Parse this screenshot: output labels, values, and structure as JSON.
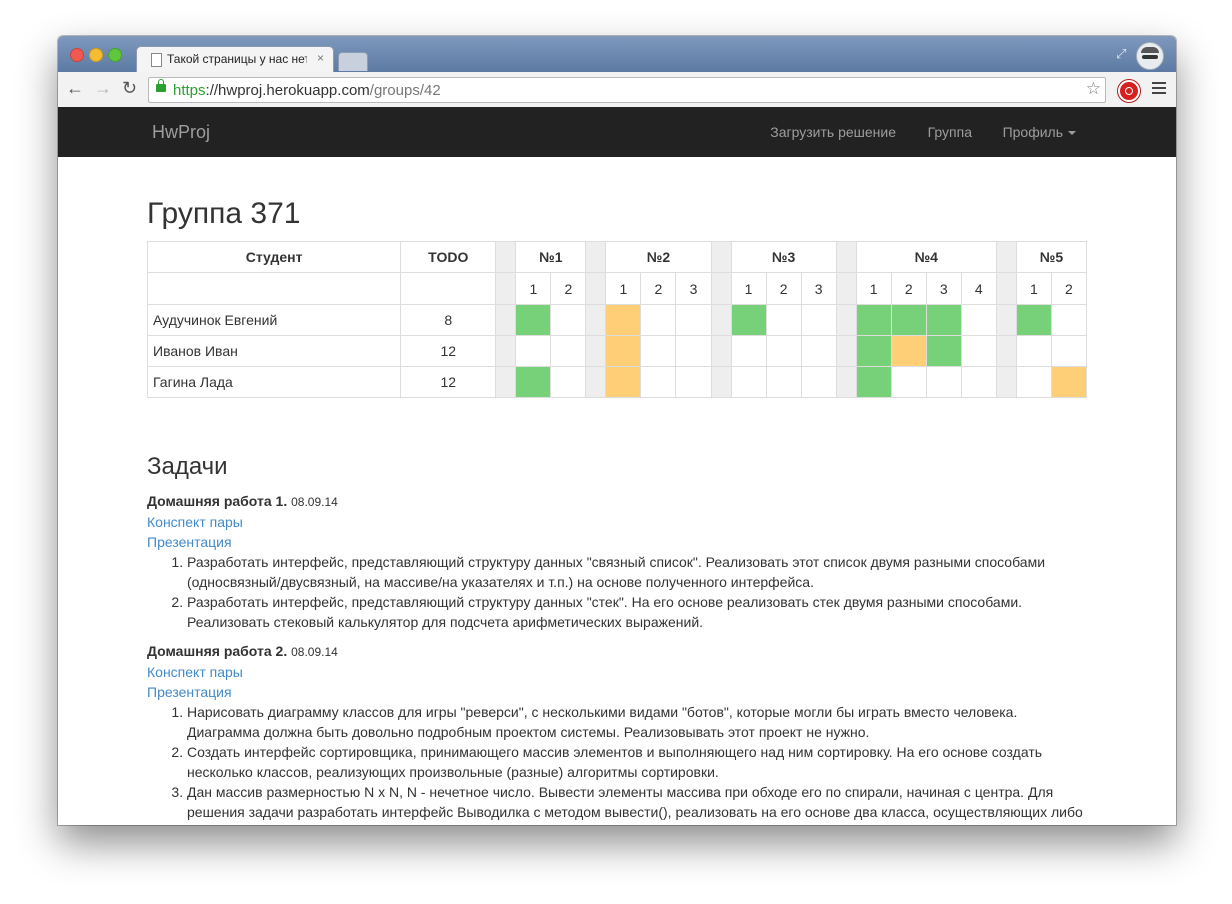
{
  "browser": {
    "tab_title": "Такой страницы у нас нет",
    "tab_close": "×",
    "url_scheme": "https",
    "url_host": "://hwproj.herokuapp.com",
    "url_path": "/groups/42"
  },
  "navbar": {
    "brand": "HwProj",
    "links": [
      "Загрузить решение",
      "Группа",
      "Профиль"
    ]
  },
  "page": {
    "title": "Группа 371"
  },
  "table": {
    "header_student": "Студент",
    "header_todo": "TODO",
    "assignments": [
      {
        "label": "№1",
        "tasks": [
          "1",
          "2"
        ]
      },
      {
        "label": "№2",
        "tasks": [
          "1",
          "2",
          "3"
        ]
      },
      {
        "label": "№3",
        "tasks": [
          "1",
          "2",
          "3"
        ]
      },
      {
        "label": "№4",
        "tasks": [
          "1",
          "2",
          "3",
          "4"
        ]
      },
      {
        "label": "№5",
        "tasks": [
          "1",
          "2"
        ]
      }
    ],
    "rows": [
      {
        "student": "Аудучинок Евгений",
        "todo": "8",
        "status": [
          [
            "ok",
            ""
          ],
          [
            "part",
            "",
            ""
          ],
          [
            "ok",
            "",
            ""
          ],
          [
            "ok",
            "ok",
            "ok",
            ""
          ],
          [
            "ok",
            ""
          ]
        ]
      },
      {
        "student": "Иванов Иван",
        "todo": "12",
        "status": [
          [
            "",
            ""
          ],
          [
            "part",
            "",
            ""
          ],
          [
            "",
            "",
            ""
          ],
          [
            "ok",
            "part",
            "ok",
            ""
          ],
          [
            "",
            ""
          ]
        ]
      },
      {
        "student": "Гагина Лада",
        "todo": "12",
        "status": [
          [
            "ok",
            ""
          ],
          [
            "part",
            "",
            ""
          ],
          [
            "",
            "",
            ""
          ],
          [
            "ok",
            "",
            "",
            ""
          ],
          [
            "",
            "part"
          ]
        ]
      }
    ],
    "colors": {
      "ok": "#77d178",
      "part": "#fecf76",
      "separator": "#eeeeee"
    }
  },
  "tasks": {
    "title": "Задачи",
    "homeworks": [
      {
        "name": "Домашняя работа 1.",
        "date": "08.09.14",
        "links": [
          "Конспект пары",
          "Презентация"
        ],
        "items": [
          "Разработать интерфейс, представляющий структуру данных \"связный список\". Реализовать этот список двумя разными способами (односвязный/двусвязный, на массиве/на указателях и т.п.) на основе полученного интерфейса.",
          "Разработать интерфейс, представляющий структуру данных \"стек\". На его основе реализовать стек двумя разными способами. Реализовать стековый калькулятор для подсчета арифметических выражений."
        ]
      },
      {
        "name": "Домашняя работа 2.",
        "date": "08.09.14",
        "links": [
          "Конспект пары",
          "Презентация"
        ],
        "items": [
          "Нарисовать диаграмму классов для игры \"реверси\", с несколькими видами \"ботов\", которые могли бы играть вместо человека. Диаграмма должна быть довольно подробным проектом системы. Реализовывать этот проект не нужно.",
          "Создать интерфейс сортировщика, принимающего массив элементов и выполняющего над ним сортировку. На его основе создать несколько классов, реализующих произвольные (разные) алгоритмы сортировки.",
          "Дан массив размерностью N x N, N - нечетное число. Вывести элементы массива при обходе его по спирали, начиная с центра. Для решения задачи разработать интерфейс Выводилка с методом вывести(), реализовать на его основе два класса, осуществляющих либо вывод на консоль либо в файл. Написать программу, которая по желанию пользователя выбирает реализацию Выводилки и выводит массив."
        ]
      }
    ]
  }
}
